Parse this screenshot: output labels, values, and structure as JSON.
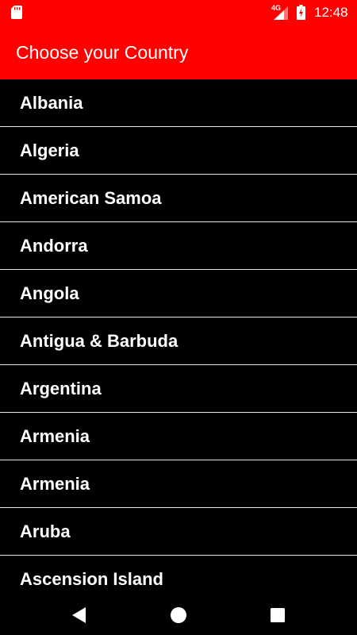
{
  "status_bar": {
    "network_label": "4G",
    "time": "12:48",
    "icons": [
      "sd-card-icon",
      "signal-icon",
      "battery-charging-icon"
    ]
  },
  "app_bar": {
    "title": "Choose your Country"
  },
  "countries": [
    "Albania",
    "Algeria",
    "American Samoa",
    "Andorra",
    "Angola",
    "Antigua & Barbuda",
    "Argentina",
    "Armenia",
    "Armenia",
    "Aruba",
    "Ascension Island"
  ],
  "nav_bar": {
    "icons": [
      "back-icon",
      "home-icon",
      "recents-icon"
    ]
  },
  "colors": {
    "accent": "#ff0000",
    "background": "#000000",
    "text": "#ffffff",
    "divider": "#e6e6e6"
  }
}
